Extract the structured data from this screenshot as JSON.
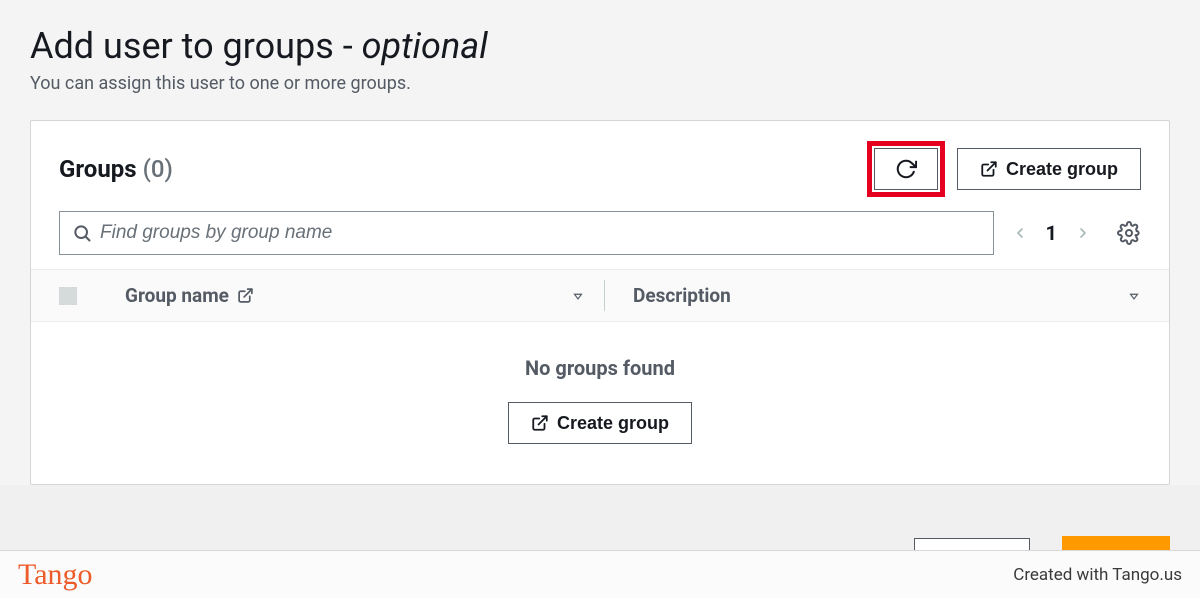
{
  "header": {
    "title_prefix": "Add user to groups - ",
    "title_suffix": "optional",
    "subtitle": "You can assign this user to one or more groups."
  },
  "panel": {
    "title": "Groups",
    "count": "(0)",
    "create_label": "Create group"
  },
  "search": {
    "placeholder": "Find groups by group name"
  },
  "pager": {
    "page": "1"
  },
  "table": {
    "col_group": "Group name",
    "col_desc": "Description"
  },
  "empty": {
    "message": "No groups found",
    "cta": "Create group"
  },
  "footer": {
    "logo": "Tango",
    "credit": "Created with Tango.us"
  }
}
